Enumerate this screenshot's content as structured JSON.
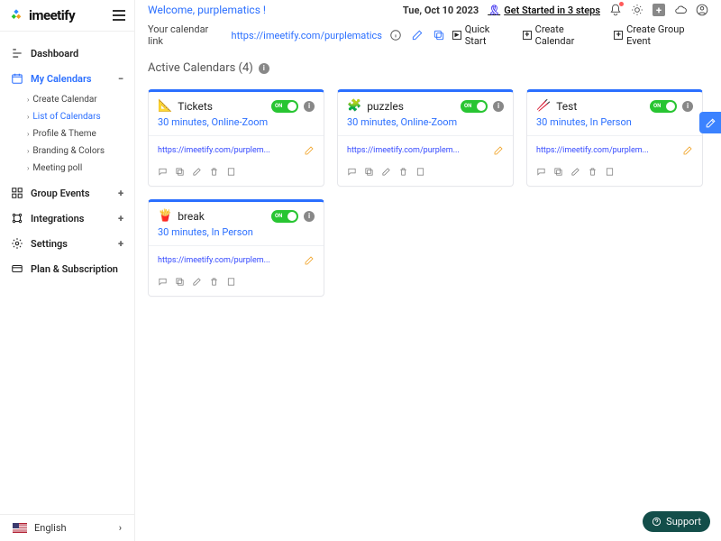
{
  "brand": {
    "name": "imeetify"
  },
  "sidebar": {
    "items": [
      {
        "label": "Dashboard"
      },
      {
        "label": "My Calendars"
      },
      {
        "label": "Group Events"
      },
      {
        "label": "Integrations"
      },
      {
        "label": "Settings"
      },
      {
        "label": "Plan & Subscription"
      }
    ],
    "submenu": [
      {
        "label": "Create Calendar"
      },
      {
        "label": "List of Calendars"
      },
      {
        "label": "Profile & Theme"
      },
      {
        "label": "Branding & Colors"
      },
      {
        "label": "Meeting poll"
      }
    ],
    "language": "English"
  },
  "header": {
    "welcome": "Welcome, purplematics !",
    "date": "Tue, Oct 10 2023",
    "get_started": "Get Started in 3 steps",
    "link_label": "Your calendar link",
    "link_url": "https://imeetify.com/purplematics",
    "quick_start": "Quick Start",
    "create_calendar": "Create Calendar",
    "create_group_event": "Create Group Event"
  },
  "section": {
    "title": "Active Calendars (4)"
  },
  "toggle": {
    "on_label": "ON"
  },
  "calendars": [
    {
      "emoji": "📐",
      "name": "Tickets",
      "sub": "30 minutes, Online-Zoom",
      "link": "https://imeetify.com/purplem..."
    },
    {
      "emoji": "🧩",
      "name": "puzzles",
      "sub": "30 minutes, Online-Zoom",
      "link": "https://imeetify.com/purplem..."
    },
    {
      "emoji": "🥢",
      "name": "Test",
      "sub": "30 minutes, In Person",
      "link": "https://imeetify.com/purplem..."
    },
    {
      "emoji": "🍟",
      "name": "break",
      "sub": "30 minutes, In Person",
      "link": "https://imeetify.com/purplem..."
    }
  ],
  "support_label": "Support"
}
